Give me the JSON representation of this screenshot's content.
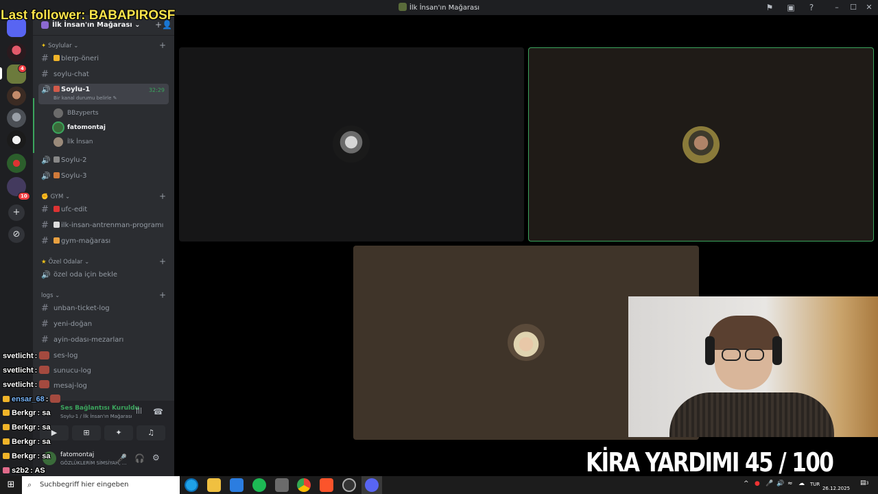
{
  "window": {
    "title": "İlk İnsan'ın Mağarası",
    "buttons": {
      "inbox": "⚑",
      "toggle": "▣",
      "help": "?",
      "minimize": "–",
      "maximize": "☐",
      "close": "✕"
    }
  },
  "server_rail": {
    "badges": [
      "4",
      "10"
    ],
    "add_label": "+",
    "explore_label": "⊘"
  },
  "server": {
    "name": "İlk İnsan'ın Mağarası ⌄",
    "invite_icon": "+👤"
  },
  "categories": [
    {
      "name": "Soylular ⌄",
      "add": "+"
    },
    {
      "name": "GYM ⌄",
      "add": "+"
    },
    {
      "name": "Özel Odalar ⌄",
      "add": "+"
    },
    {
      "name": "logs ⌄",
      "add": "+"
    }
  ],
  "channels": {
    "soylular": [
      {
        "name": "blerp-öneri",
        "icon": "#"
      },
      {
        "name": "soylu-chat",
        "icon": "#"
      },
      {
        "name": "Soylu-1",
        "icon": "🔊",
        "status": "Bir kanal durumu belirle ✎",
        "timer": "32:29"
      },
      {
        "name": "Soylu-2",
        "icon": "🔊"
      },
      {
        "name": "Soylu-3",
        "icon": "🔊"
      }
    ],
    "voice_users": [
      {
        "name": "BBzyperts"
      },
      {
        "name": "fatomontaj"
      },
      {
        "name": "İlk İnsan"
      }
    ],
    "gym": [
      {
        "name": "ufc-edit",
        "icon": "#"
      },
      {
        "name": "ilk-insan-antrenman-programı",
        "icon": "#"
      },
      {
        "name": "gym-mağarası",
        "icon": "#"
      }
    ],
    "ozel": [
      {
        "name": "özel oda için bekle",
        "icon": "🔊"
      }
    ],
    "logs": [
      {
        "name": "unban-ticket-log",
        "icon": "#"
      },
      {
        "name": "yeni-doğan",
        "icon": "#"
      },
      {
        "name": "ayin-odası-mezarları",
        "icon": "#"
      },
      {
        "name": "ses-log",
        "icon": "#"
      },
      {
        "name": "sunucu-log",
        "icon": "#"
      },
      {
        "name": "mesaj-log",
        "icon": "#"
      }
    ]
  },
  "voice_panel": {
    "connected": "Ses Bağlantısı Kuruldu",
    "location": "Soylu-1 / İlk İnsan'ın Mağarası",
    "user": "fatomontaj",
    "user_status": "GÖZLÜKLERİM SİMSİYAH, ...",
    "icons": {
      "noise": "|||",
      "disconnect": "☎",
      "camera": "▶",
      "screen": "⊞",
      "activity": "✦",
      "soundboard": "♫",
      "mic": "🎤",
      "headset": "🎧",
      "settings": "⚙"
    }
  },
  "overlay": {
    "last_follower": "Last follower: BABAPIROSF",
    "chat": [
      {
        "user": "svetlicht",
        "sep": ":",
        "msg": ""
      },
      {
        "user": "svetlicht",
        "sep": ":",
        "msg": ""
      },
      {
        "user": "svetlicht",
        "sep": ":",
        "msg": ""
      },
      {
        "user": "ensar_68",
        "sep": ":",
        "msg": ""
      },
      {
        "user": "Berkgr",
        "sep": ":",
        "msg": "sa"
      },
      {
        "user": "Berkgr",
        "sep": ":",
        "msg": "sa"
      },
      {
        "user": "Berkgr",
        "sep": ":",
        "msg": "sa"
      },
      {
        "user": "Berkgr",
        "sep": ":",
        "msg": "sa"
      },
      {
        "user": "s2b2",
        "sep": ":",
        "msg": "AS"
      }
    ],
    "goal": "KİRA YARDIMI  45 / 100",
    "goal_current": 45,
    "goal_target": 100
  },
  "taskbar": {
    "start": "⊞",
    "search_placeholder": "Suchbegriff hier eingeben",
    "search_icon": "⌕",
    "lang": "TUR",
    "date": "26.12.2025",
    "notif_count": "3"
  },
  "colors": {
    "accent_green": "#3ba55d",
    "discord_dark": "#1e1f22",
    "sidebar": "#2b2d31",
    "overlay_yellow": "#f7e24a"
  }
}
